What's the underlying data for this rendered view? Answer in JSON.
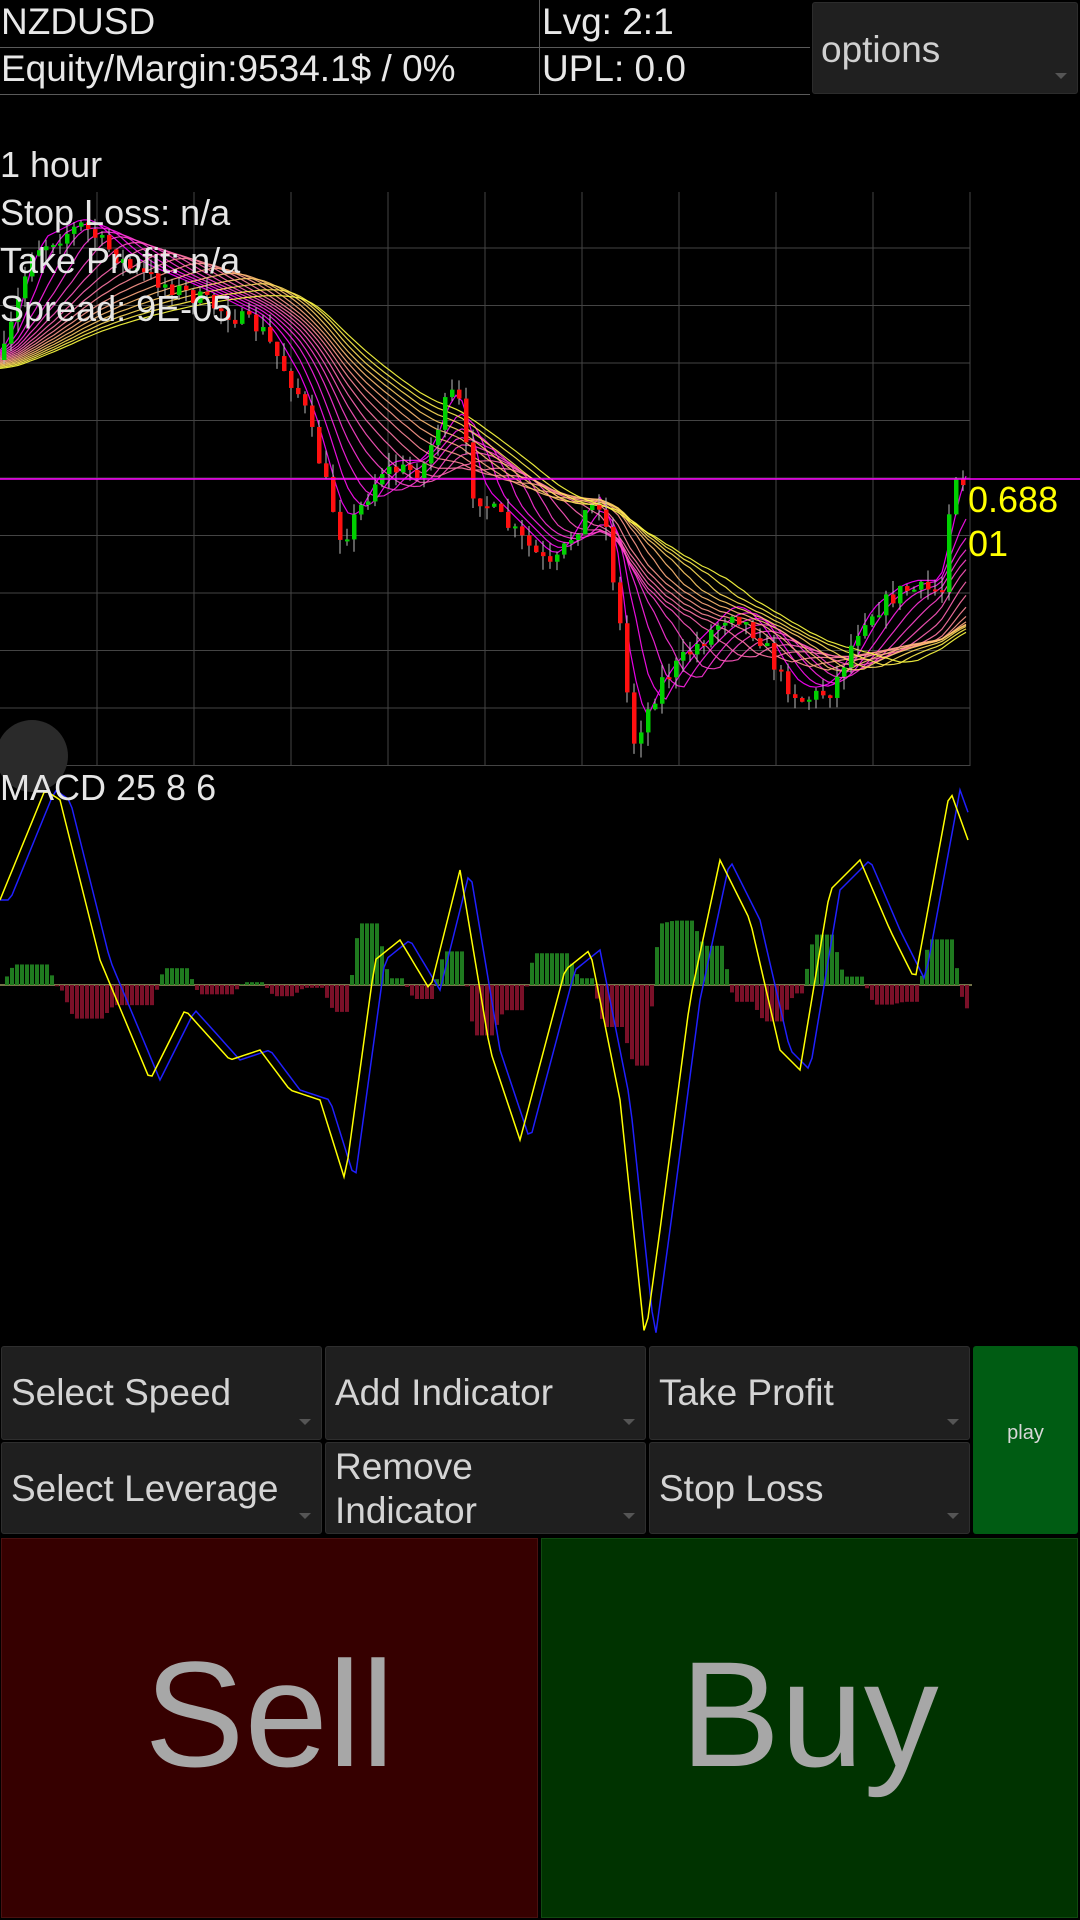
{
  "header": {
    "symbol": "NZDUSD",
    "leverage": "Lvg: 2:1",
    "equity_margin": "Equity/Margin:9534.1$ / 0%",
    "upl": "UPL: 0.0",
    "options_label": "options"
  },
  "chart_info": {
    "timeframe": "1 hour",
    "stop_loss": "Stop Loss: n/a",
    "take_profit": "Take Profit: n/a",
    "spread": "Spread: 9E-05",
    "current_price_line1": "0.688",
    "current_price_line2": "01"
  },
  "macd": {
    "label": "MACD 25 8 6"
  },
  "controls": {
    "select_speed": "Select Speed",
    "add_indicator": "Add Indicator",
    "take_profit": "Take Profit",
    "play": "play",
    "select_leverage": "Select Leverage",
    "remove_indicator": "Remove Indicator",
    "stop_loss": "Stop Loss"
  },
  "trade": {
    "sell": "Sell",
    "buy": "Buy"
  },
  "colors": {
    "bull_candle": "#00d000",
    "bear_candle": "#ff1010",
    "ribbon_fast": "#ff00ff",
    "ribbon_slow": "#ffff40",
    "macd_line": "#ffff00",
    "signal_line": "#2020ff",
    "hist_pos": "#1f7a1f",
    "hist_neg": "#7a1028",
    "price_line": "#ff00ff",
    "price_label": "#ffff00"
  }
}
